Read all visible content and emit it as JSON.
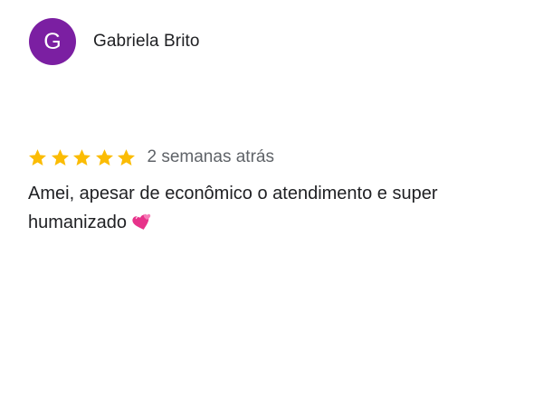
{
  "review": {
    "author": {
      "initial": "G",
      "name": "Gabriela Brito",
      "avatar_color": "#7b1fa2"
    },
    "rating": {
      "value": 5,
      "max": 5,
      "star_color": "#fbbc04"
    },
    "date": "2 semanas atrás",
    "text": "Amei, apesar de econômico o atendimento e super humanizado",
    "emoji": "two-hearts-emoji"
  }
}
